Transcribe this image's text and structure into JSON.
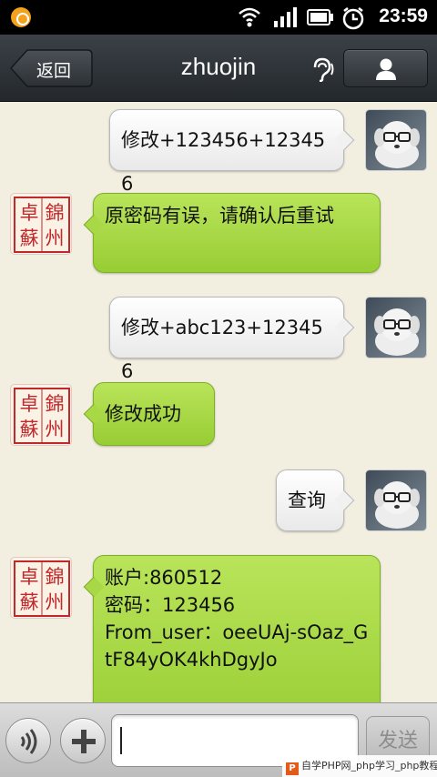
{
  "status_bar": {
    "time": "23:59",
    "icons": [
      "app-notification-icon",
      "wifi-icon",
      "signal-icon",
      "battery-icon",
      "alarm-clock-icon"
    ]
  },
  "title_bar": {
    "back_label": "返回",
    "chat_title": "zhuojin",
    "icons": [
      "earpiece-icon",
      "profile-icon"
    ]
  },
  "messages": [
    {
      "sender": "me",
      "text": "修改+123456+123456"
    },
    {
      "sender": "them",
      "text": "原密码有误，请确认后重试"
    },
    {
      "sender": "me",
      "text": "修改+abc123+123456"
    },
    {
      "sender": "them",
      "text": "修改成功"
    },
    {
      "sender": "me",
      "text": "查询"
    },
    {
      "sender": "them",
      "lines": [
        "账户:860512",
        "密码：123456",
        "From_user：oeeUAj-sOaz_GtF84yOK4khDgyJo"
      ]
    }
  ],
  "seal_avatar": {
    "characters": [
      "錦",
      "州",
      "卓",
      "蘇"
    ],
    "color": "#c0282b"
  },
  "input_bar": {
    "input_value": "",
    "send_label": "发送",
    "icons": [
      "voice-icon",
      "plus-icon"
    ]
  },
  "watermark": {
    "text": "自学PHP网_php学习_php教程"
  },
  "colors": {
    "background": "#f3efe0",
    "them_bubble": "#a8d846",
    "me_bubble": "#f1f1f1",
    "title_bar": "#2e3438"
  }
}
